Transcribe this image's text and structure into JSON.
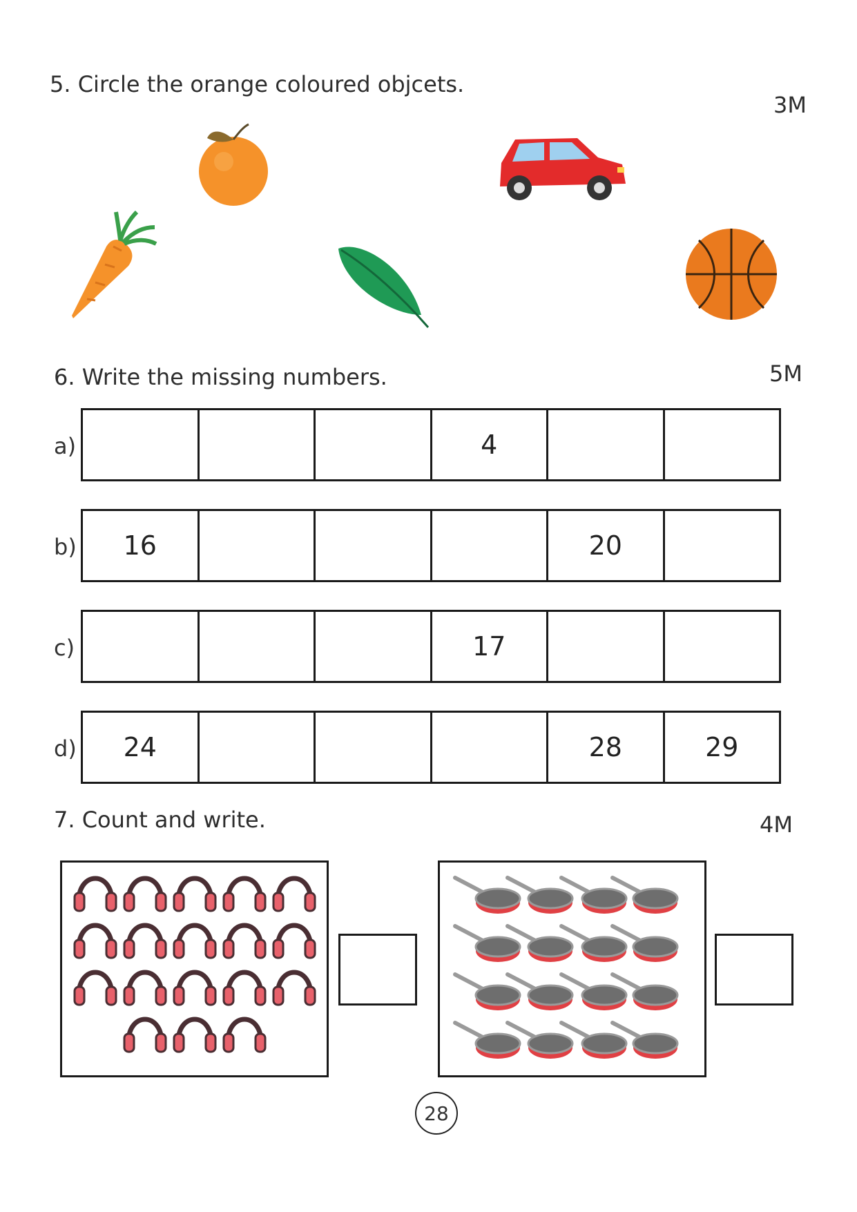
{
  "q5": {
    "text": "5.  Circle the orange coloured objcets.",
    "marks": "3M"
  },
  "q6": {
    "text": "6.  Write the missing numbers.",
    "marks": "5M",
    "rows": [
      {
        "label": "a)",
        "cells": [
          "",
          "",
          "",
          "4",
          "",
          ""
        ]
      },
      {
        "label": "b)",
        "cells": [
          "16",
          "",
          "",
          "",
          "20",
          ""
        ]
      },
      {
        "label": "c)",
        "cells": [
          "",
          "",
          "",
          "17",
          "",
          ""
        ]
      },
      {
        "label": "d)",
        "cells": [
          "24",
          "",
          "",
          "",
          "28",
          "29"
        ]
      }
    ]
  },
  "q7": {
    "text": "7.  Count and write.",
    "marks": "4M",
    "headphones_count": 18,
    "pans_count": 16
  },
  "page_number": "28",
  "colors": {
    "orange": "#f5922a",
    "red_car": "#e32b2b",
    "leaf": "#1f9a55",
    "ball": "#ea7a1e",
    "headphone": "#e8616b",
    "pan_rim": "#e04044"
  }
}
